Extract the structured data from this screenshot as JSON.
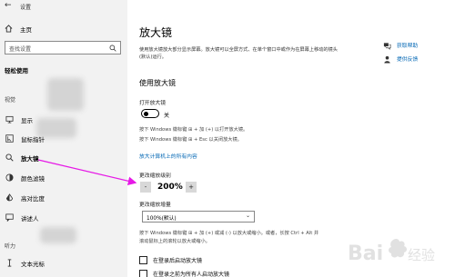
{
  "window": {
    "title": "设置"
  },
  "sidebar": {
    "home_label": "主页",
    "search_placeholder": "查找设置",
    "section_title": "轻松使用",
    "group_vision": "视觉",
    "group_hearing": "听力",
    "items": [
      {
        "label": "显示",
        "icon": "monitor-icon"
      },
      {
        "label": "鼠标指针",
        "icon": "mouse-pointer-icon"
      },
      {
        "label": "放大镜",
        "icon": "magnifier-icon",
        "active": true
      },
      {
        "label": "颜色滤镜",
        "icon": "color-filter-icon"
      },
      {
        "label": "高对比度",
        "icon": "high-contrast-icon"
      },
      {
        "label": "讲述人",
        "icon": "narrator-icon"
      },
      {
        "label": "文本光标",
        "icon": "text-cursor-icon"
      }
    ]
  },
  "main": {
    "title": "放大镜",
    "description": "使用放大镜放大部分显示屏幕。放大镜可以全屏方式、在单个窗口中或作为在屏幕上移动的镜头(默认)运行。",
    "help": [
      {
        "label": "获取帮助",
        "icon": "help-chat-icon"
      },
      {
        "label": "提供反馈",
        "icon": "feedback-icon"
      }
    ],
    "section_title": "使用放大镜",
    "toggle_label": "打开放大镜",
    "toggle_state": "关",
    "hint_open": "按下 Windows 徽标键 ⊞ + 加 (+) 以打开放大镜。",
    "hint_close": "按下 Windows 徽标键 ⊞ + Esc 以关闭放大镜。",
    "link_more": "放大计算机上的所有内容",
    "zoom_label": "更改缩放级别",
    "zoom_minus": "-",
    "zoom_value": "200%",
    "zoom_plus": "+",
    "increment_label": "更改缩放增量",
    "increment_value": "100%(默认)",
    "hint_zoom": "按下 Windows 徽标键 ⊞ + 加 (+) 或减 (-) 以放大或缩小。或者，长按 Ctrl + Alt 并滚动鼠标上的滚轮以放大或缩小。",
    "checkbox_after_login": "在登录后启动放大镜",
    "checkbox_before_login": "在登录之前为所有人启动放大镜"
  },
  "watermark_text": "Bai 经验"
}
